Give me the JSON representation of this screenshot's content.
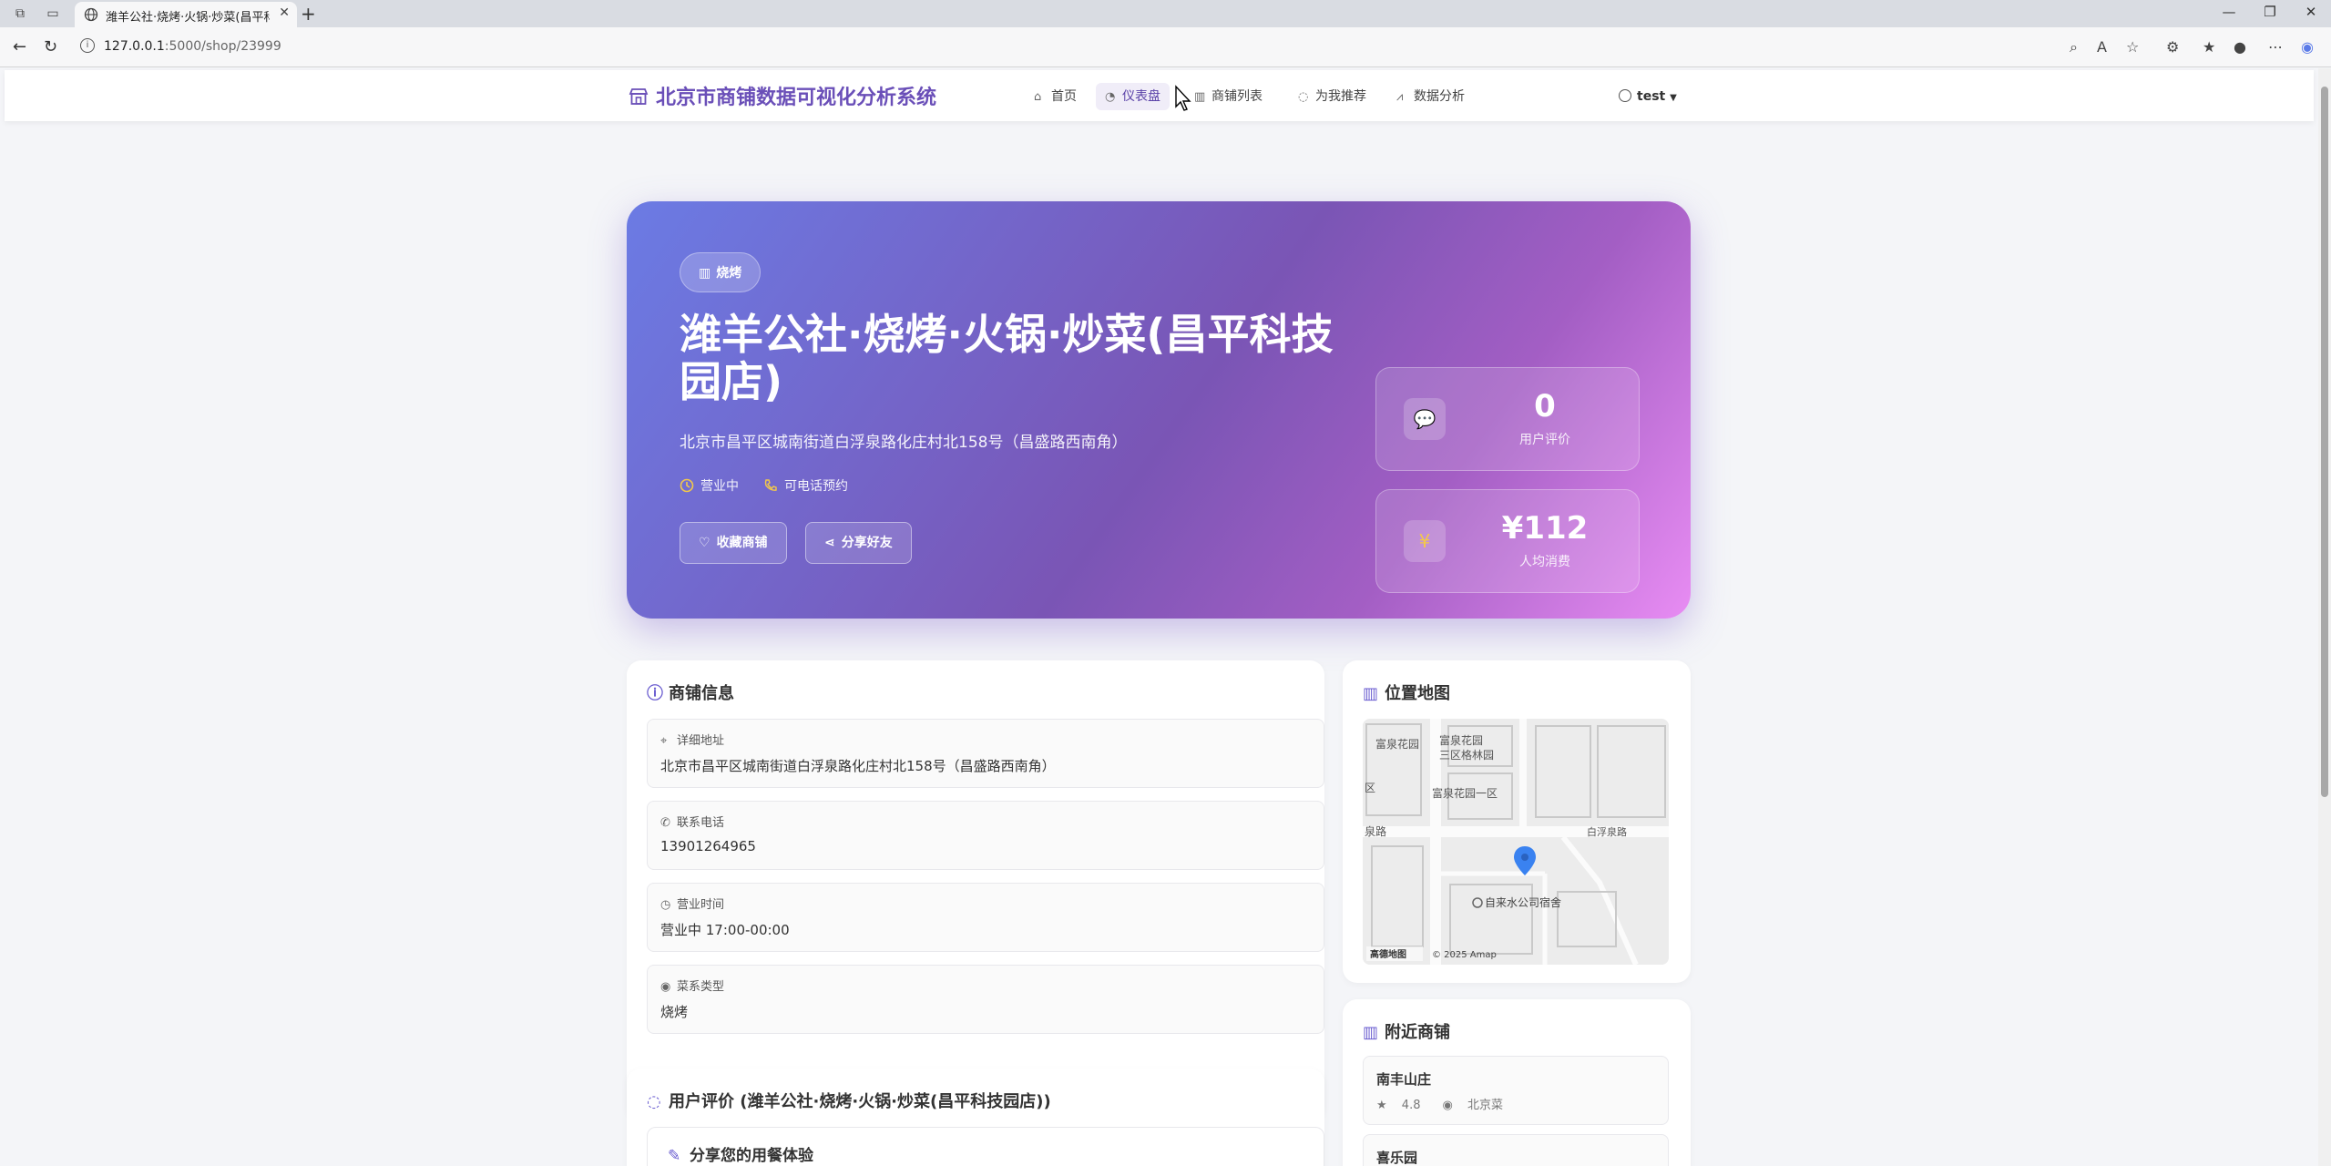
{
  "browser": {
    "tab_title": "潍羊公社·烧烤·火锅·炒菜(昌平科技园店)",
    "url_host": "127.0.0.1",
    "url_path": ":5000/shop/23999"
  },
  "navbar": {
    "brand": "北京市商铺数据可视化分析系统",
    "links": [
      {
        "label": "首页",
        "icon": "home-icon"
      },
      {
        "label": "仪表盘",
        "icon": "dashboard-icon"
      },
      {
        "label": "商铺列表",
        "icon": "shop-icon"
      },
      {
        "label": "为我推荐",
        "icon": "lightbulb-icon"
      },
      {
        "label": "数据分析",
        "icon": "chart-icon"
      }
    ],
    "user": "test"
  },
  "hero": {
    "category": "烧烤",
    "title": "潍羊公社·烧烤·火锅·炒菜(昌平科技园店)",
    "address": "北京市昌平区城南街道白浮泉路化庄村北158号（昌盛路西南角）",
    "status": "营业中",
    "booking": "可电话预约",
    "favorite_label": "收藏商铺",
    "share_label": "分享好友",
    "stats": [
      {
        "value": "0",
        "label": "用户评价",
        "icon": "comment-icon"
      },
      {
        "value": "¥112",
        "label": "人均消费",
        "icon": "yen-icon"
      }
    ]
  },
  "shop_info": {
    "title": "商铺信息",
    "items": [
      {
        "label": "详细地址",
        "value": "北京市昌平区城南街道白浮泉路化庄村北158号（昌盛路西南角）",
        "icon": "location-icon"
      },
      {
        "label": "联系电话",
        "value": "13901264965",
        "icon": "phone-icon"
      },
      {
        "label": "营业时间",
        "value": "营业中 17:00-00:00",
        "icon": "clock-icon"
      },
      {
        "label": "菜系类型",
        "value": "烧烤",
        "icon": "target-icon"
      }
    ]
  },
  "map": {
    "title": "位置地图",
    "labels": [
      "富泉花园",
      "富泉花园三区格林园",
      "富泉花园一区",
      "白浮泉路",
      "泉路",
      "区",
      "自来水公司宿舍",
      "高德地图",
      "© 2025 Amap"
    ]
  },
  "nearby": {
    "title": "附近商铺",
    "items": [
      {
        "name": "南丰山庄",
        "rating": "4.8",
        "category": "北京菜"
      },
      {
        "name": "喜乐园",
        "rating": "",
        "category": ""
      }
    ]
  },
  "reviews": {
    "title": "用户评价 (潍羊公社·烧烤·火锅·炒菜(昌平科技园店))",
    "form_title": "分享您的用餐体验"
  },
  "colors": {
    "brand": "#6a4fb8",
    "hero_start": "#6b7be4",
    "hero_end": "#e88cf3",
    "accent_icon": "#f3c84a"
  }
}
